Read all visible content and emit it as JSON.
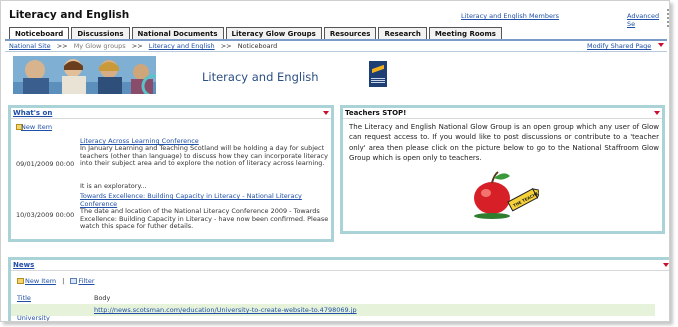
{
  "header": {
    "site_title": "Literacy and English",
    "members_link": "Literacy and English Members",
    "advanced_link": "Advanced Se"
  },
  "tabs": [
    {
      "label": "Noticeboard",
      "active": true
    },
    {
      "label": "Discussions",
      "active": false
    },
    {
      "label": "National Documents",
      "active": false
    },
    {
      "label": "Literacy Glow Groups",
      "active": false
    },
    {
      "label": "Resources",
      "active": false
    },
    {
      "label": "Research",
      "active": false
    },
    {
      "label": "Meeting Rooms",
      "active": false
    }
  ],
  "breadcrumb": {
    "items": [
      "National Site",
      "My Glow groups",
      "Literacy and English",
      "Noticeboard"
    ],
    "separator": ">>",
    "modify_link": "Modify Shared Page"
  },
  "banner": {
    "title": "Literacy and English"
  },
  "whats_on": {
    "title": "What's on",
    "new_item": "New Item",
    "items": [
      {
        "date": "09/01/2009 00:00",
        "title": "Literacy Across Learning Conference",
        "body": "In January Learning and Teaching Scotland will be holding a day for subject teachers (other than language) to discuss how they can incorporate literacy into their subject area and to explore the notion of literacy across learning.",
        "extra": "It is an exploratory..."
      },
      {
        "date": "10/03/2009 00:00",
        "title": "Towards Excellence: Building Capacity in Literacy - National Literacy Conference",
        "body": "The date and location of the National Literacy Conference 2009 - Towards Excellence: Building Capacity in Literacy - have now been confirmed. Please watch this space for futher details."
      }
    ]
  },
  "teachers": {
    "title": "Teachers STOP!",
    "text": "The Literacy and English National Glow Group is an open group which any user of Glow can request access to. If you would like to post discussions or contribute to a 'teacher only' area then please click on the picture below to go to the National Staffroom Glow Group which is open only to teachers.",
    "image_label": "THE TEACHER"
  },
  "news": {
    "title": "News",
    "new_item": "New Item",
    "filter": "Filter",
    "tool_sep": "|",
    "columns": [
      "Title",
      "Body"
    ],
    "rows": [
      {
        "title": "University",
        "body": "http://news.scotsman.com/education/University-to-create-website-to.4798069.jp"
      }
    ]
  },
  "colors": {
    "panel_border": "#a9d3d6",
    "link": "#1f4fa6",
    "arrow": "#c8102e",
    "news_row_bg": "#e6f2da"
  }
}
